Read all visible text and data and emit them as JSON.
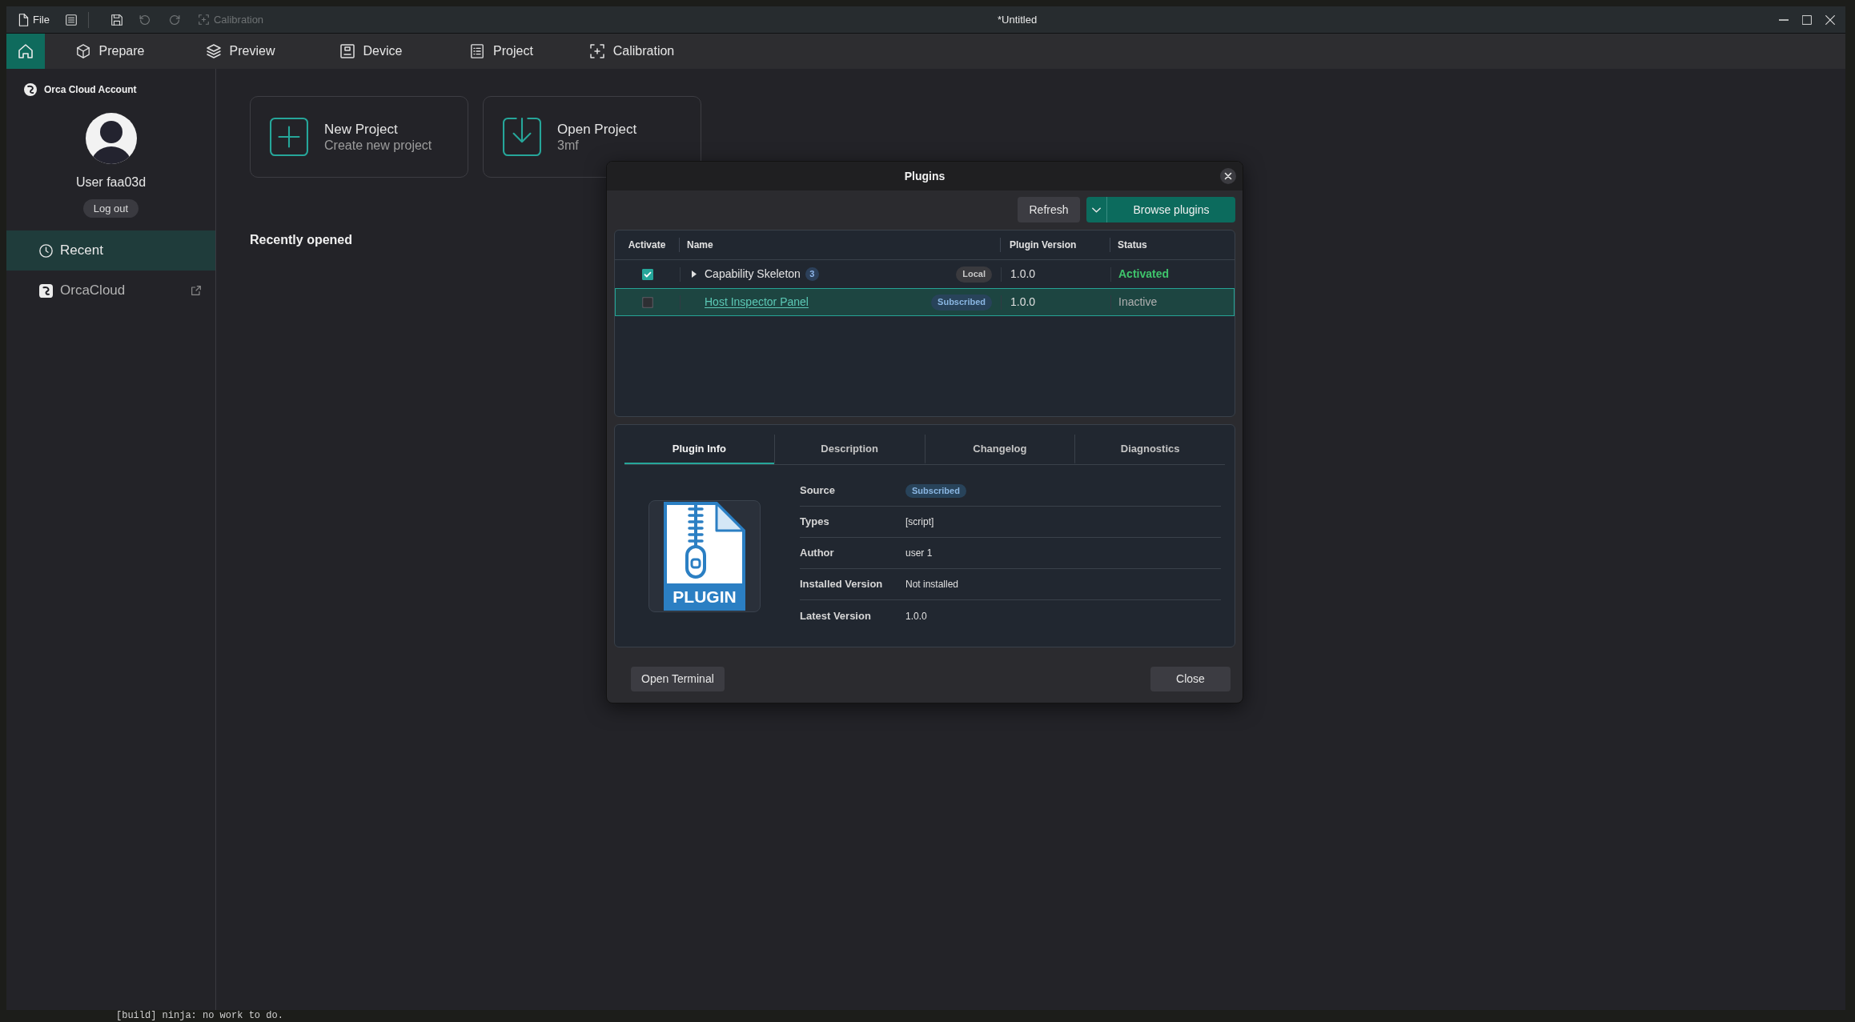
{
  "title_bar": {
    "menu_label": "File",
    "tools": [
      {
        "kind": "save",
        "disabled": false
      },
      {
        "kind": "undo",
        "disabled": true
      },
      {
        "kind": "redo",
        "disabled": true
      },
      {
        "kind": "calibration",
        "label": "Calibration",
        "disabled": true
      }
    ],
    "title": "*Untitled"
  },
  "tabs": [
    {
      "kind": "home",
      "selected": true
    },
    {
      "kind": "prepare",
      "label": "Prepare",
      "selected": false
    },
    {
      "kind": "preview",
      "label": "Preview",
      "selected": false
    },
    {
      "kind": "device",
      "label": "Device",
      "selected": false
    },
    {
      "kind": "project",
      "label": "Project",
      "selected": false
    },
    {
      "kind": "calibration",
      "label": "Calibration",
      "selected": false
    }
  ],
  "sidebar": {
    "account_title": "Orca Cloud Account",
    "user_name": "User faa03d",
    "logout_button": "Log out",
    "items": [
      {
        "kind": "recent",
        "label": "Recent",
        "selected": true,
        "external": false
      },
      {
        "kind": "cloud",
        "label": "OrcaCloud",
        "selected": false,
        "external": true
      }
    ]
  },
  "home": {
    "cards": [
      {
        "kind": "new",
        "title": "New Project",
        "subtitle": "Create new project"
      },
      {
        "kind": "open",
        "title": "Open Project",
        "subtitle": "3mf"
      }
    ],
    "recent_heading": "Recently opened"
  },
  "plugins_dialog": {
    "title": "Plugins",
    "refresh_button": "Refresh",
    "browse_button": "Browse plugins",
    "table": {
      "columns": [
        "Activate",
        "Name",
        "Plugin Version",
        "Status"
      ],
      "rows": [
        {
          "checked": true,
          "expandable": true,
          "name": "Capability Skeleton",
          "link": false,
          "count": "3",
          "source": {
            "label": "Local",
            "kind": "local"
          },
          "version": "1.0.0",
          "status": "Activated",
          "active": true,
          "selected": false
        },
        {
          "checked": false,
          "expandable": false,
          "name": "Host Inspector Panel",
          "link": true,
          "source": {
            "label": "Subscribed",
            "kind": "subscribed"
          },
          "version": "1.0.0",
          "status": "Inactive",
          "active": false,
          "selected": true
        }
      ]
    },
    "detail_tabs": [
      {
        "label": "Plugin Info",
        "selected": true
      },
      {
        "label": "Description",
        "selected": false
      },
      {
        "label": "Changelog",
        "selected": false
      },
      {
        "label": "Diagnostics",
        "selected": false
      }
    ],
    "thumbnail_label": "PLUGIN",
    "fields": [
      {
        "label": "Source",
        "kind": "badge",
        "value": "Subscribed"
      },
      {
        "label": "Types",
        "kind": "text",
        "value": "[script]"
      },
      {
        "label": "Author",
        "kind": "text",
        "value": "user 1"
      },
      {
        "label": "Installed Version",
        "kind": "text",
        "value": "Not installed"
      },
      {
        "label": "Latest Version",
        "kind": "text",
        "value": "1.0.0"
      }
    ],
    "open_terminal_button": "Open Terminal",
    "close_button": "Close"
  },
  "terminal": {
    "line": "[build] ninja: no work to do."
  }
}
